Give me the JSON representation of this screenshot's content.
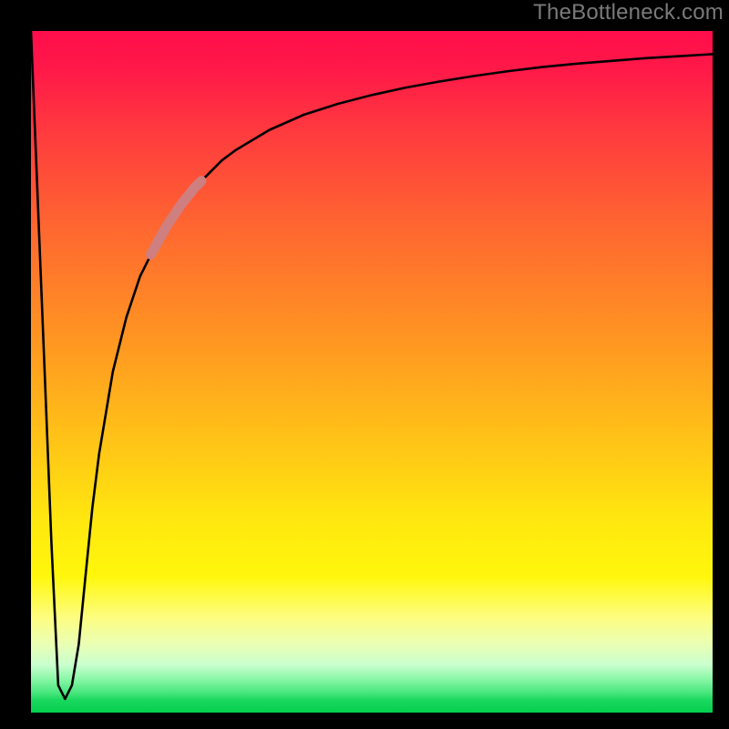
{
  "watermark": "TheBottleneck.com",
  "colors": {
    "bg_frame": "#000000",
    "gradient_top": "#ff0d4b",
    "gradient_bottom": "#04cf4e",
    "curve": "#000000",
    "highlight": "#cf7f7f"
  },
  "chart_data": {
    "type": "line",
    "title": "",
    "xlabel": "",
    "ylabel": "",
    "xlim": [
      0,
      100
    ],
    "ylim": [
      0,
      100
    ],
    "grid": false,
    "legend": false,
    "x": [
      0,
      1,
      2,
      3,
      4,
      5,
      6,
      7,
      8,
      9,
      10,
      12,
      14,
      16,
      18,
      20,
      22,
      24,
      26,
      28,
      30,
      35,
      40,
      45,
      50,
      55,
      60,
      65,
      70,
      75,
      80,
      85,
      90,
      95,
      100
    ],
    "values": [
      100,
      75,
      50,
      25,
      4,
      2,
      4,
      10,
      20,
      30,
      38,
      50,
      58,
      64,
      68,
      71.5,
      74.5,
      77,
      79,
      81,
      82.5,
      85.5,
      87.7,
      89.3,
      90.6,
      91.7,
      92.6,
      93.4,
      94.1,
      94.7,
      95.2,
      95.6,
      96.0,
      96.3,
      96.6
    ],
    "notch": {
      "x": 5,
      "depth": 2
    },
    "highlight_segment": {
      "x_range": [
        19,
        25
      ],
      "y_range": [
        70,
        78
      ],
      "label": "highlighted-range"
    },
    "highlight_dot": {
      "x": 18.2,
      "y": 68.5
    }
  }
}
